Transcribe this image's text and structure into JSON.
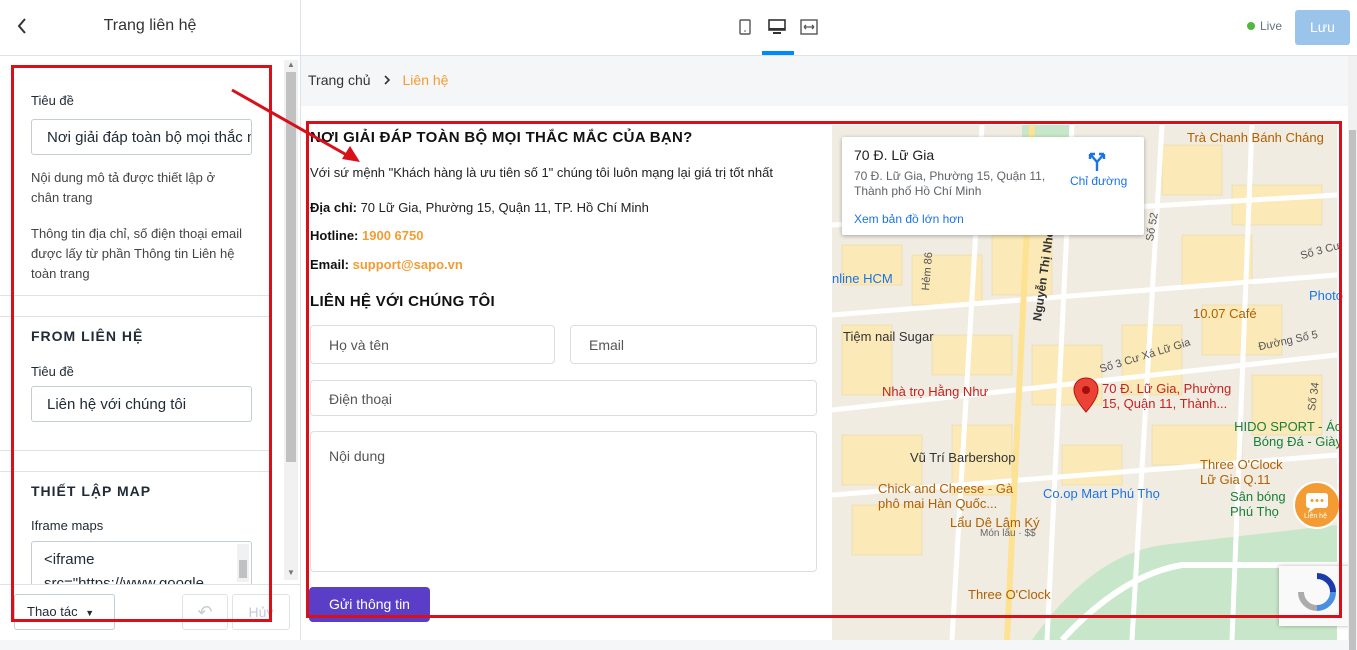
{
  "topbar": {
    "back_icon": "chevron-left-icon",
    "title": "Trang liên hệ",
    "live_label": "Live",
    "save_label": "Lưu"
  },
  "devices": [
    "mobile-icon",
    "desktop-icon",
    "fullwidth-icon"
  ],
  "sidebar": {
    "title_label": "Tiêu đề",
    "title_value": "Nơi giải đáp toàn bộ mọi thắc mắc của bạn?",
    "help1": "Nội dung mô tả được thiết lập ở chân trang",
    "help2": "Thông tin địa chỉ, số điện thoại email được lấy từ phần Thông tin Liên hệ toàn trang",
    "form_section": "FROM LIÊN HỆ",
    "form_title_label": "Tiêu đề",
    "form_title_value": "Liên hệ với chúng tôi",
    "map_section": "THIẾT LẬP MAP",
    "iframe_label": "Iframe maps",
    "iframe_value": "<iframe src=\"https://www.google"
  },
  "footer": {
    "action_label": "Thao tác",
    "undo_icon": "undo-icon",
    "redo_label": "Hủy"
  },
  "breadcrumb": {
    "home": "Trang chủ",
    "current": "Liên hệ"
  },
  "page": {
    "heading": "NƠI GIẢI ĐÁP TOÀN BỘ MỌI THẮC MẮC CỦA BẠN?",
    "mission": "Với sứ mệnh \"Khách hàng là ưu tiên số 1\" chúng tôi luôn mạng lại giá trị tốt nhất",
    "address_label": "Địa chỉ:",
    "address_value": " 70 Lữ Gia, Phường 15, Quận 11, TP. Hồ Chí Minh",
    "hotline_label": "Hotline:",
    "hotline_value": " 1900 6750",
    "email_label": "Email:",
    "email_value": " support@sapo.vn",
    "form_heading": "LIÊN HỆ VỚI CHÚNG TÔI",
    "name_placeholder": "Họ và tên",
    "email_placeholder": "Email",
    "phone_placeholder": "Điện thoại",
    "content_placeholder": "Nội dung",
    "submit_label": "Gửi thông tin"
  },
  "map": {
    "place_name": "70 Đ. Lữ Gia",
    "place_address": "70 Đ. Lữ Gia, Phường 15, Quận 11, Thành phố Hồ Chí Minh",
    "directions_label": "Chỉ đường",
    "larger_map_label": "Xem bản đồ lớn hơn",
    "pin_label": "70 Đ. Lữ Gia, Phường 15, Quận 11, Thành...",
    "labels": {
      "tra_chanh": "Trà Chanh Bánh Cháng",
      "nail": "Tiệm nail Sugar",
      "online": "nline HCM",
      "nha_tro": "Nhà trọ Hằng Như",
      "cafe": "10.07 Café",
      "barber": "Vũ Trí Barbershop",
      "hido": "HIDO SPORT - Áo Bóng Đá - Giày",
      "three_clock1": "Three O'Clock Lữ Gia Q.11",
      "chick": "Chick and Cheese - Gà phô mai Hàn Quốc...",
      "coop": "Co.op Mart Phú Thọ",
      "san_bong": "Sân bóng Phú Thọ",
      "lau_de": "Lẩu Dê Lâm Ký",
      "lau_de_sub": "Món lẩu · $$",
      "three_clock2": "Three O'Clock",
      "street1": "Nguyễn Thị Nhỏ",
      "street2": "Số 3 Cư Xá Lữ Gia",
      "street3": "Đường Số 5",
      "street4": "Hẻm 86",
      "street5": "Số 52",
      "street6": "Số 34",
      "photo": "Photo",
      "so3": "Số 3 Cư"
    },
    "chat_label": "Liên hệ"
  },
  "colors": {
    "accent": "#f39c33",
    "primary": "#5a3ec8",
    "highlight": "#d8101a",
    "save": "#9ac4ea"
  }
}
